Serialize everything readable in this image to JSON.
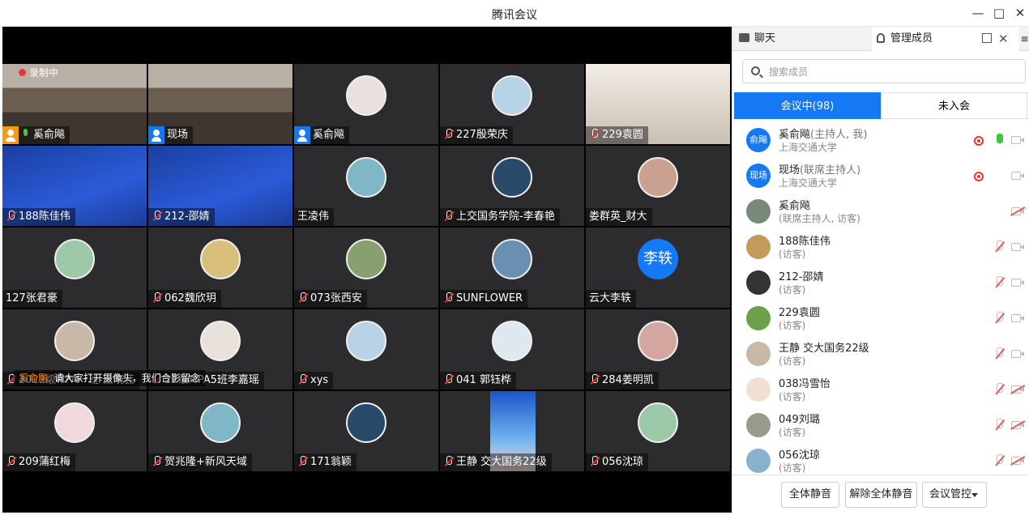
{
  "window": {
    "title": "腾讯会议"
  },
  "recording": {
    "label": "录制中"
  },
  "caption": {
    "speaker": "奚俞飚:",
    "text": "请大家打开摄像头，我们合影留念"
  },
  "tiles": [
    {
      "name": "奚俞飚",
      "kind": "room",
      "badge": "host"
    },
    {
      "name": "现场",
      "kind": "room",
      "badge": "cohost"
    },
    {
      "name": "奚俞飚",
      "kind": "avatar",
      "badge": "cohost-plain"
    },
    {
      "name": "227殷荣庆",
      "kind": "avatar",
      "mic": "off"
    },
    {
      "name": "229袁圆",
      "kind": "photo",
      "mic": "off"
    },
    {
      "name": "188陈佳伟",
      "kind": "screen",
      "mic": "off"
    },
    {
      "name": "212-邵婧",
      "kind": "screen",
      "mic": "off"
    },
    {
      "name": "王凌伟",
      "kind": "avatar"
    },
    {
      "name": "上交国务学院-李春艳",
      "kind": "avatar",
      "mic": "off"
    },
    {
      "name": "娄群英_财大",
      "kind": "avatar"
    },
    {
      "name": "127张君豪",
      "kind": "avatar"
    },
    {
      "name": "062魏欣玥",
      "kind": "avatar",
      "mic": "off"
    },
    {
      "name": "073张西安",
      "kind": "avatar",
      "mic": "off"
    },
    {
      "name": "SUNFLOWER",
      "kind": "avatar",
      "mic": "off"
    },
    {
      "name": "云大李轶",
      "kind": "letter",
      "letter": "李轶"
    },
    {
      "name": "2022级MPA一班-王晓芸",
      "kind": "avatar",
      "mic": "off"
    },
    {
      "name": "22级MPA5班李嘉瑶",
      "kind": "avatar",
      "mic": "off"
    },
    {
      "name": "xys",
      "kind": "avatar",
      "mic": "off"
    },
    {
      "name": "041 郭钰桦",
      "kind": "avatar",
      "mic": "off"
    },
    {
      "name": "284姜明凯",
      "kind": "avatar",
      "mic": "off"
    },
    {
      "name": "209蒲红梅",
      "kind": "avatar",
      "mic": "off"
    },
    {
      "name": "贺兆隆+新风天域",
      "kind": "avatar",
      "mic": "off"
    },
    {
      "name": "171翁颖",
      "kind": "avatar",
      "mic": "off"
    },
    {
      "name": "王静 交大国务22级",
      "kind": "phone",
      "mic": "off"
    },
    {
      "name": "056沈琼",
      "kind": "avatar",
      "mic": "off"
    }
  ],
  "panel": {
    "tab_chat": "聊天",
    "tab_members": "管理成员",
    "search_placeholder": "搜索成员",
    "seg_in": "会议中(98)",
    "seg_out": "未入会",
    "members": [
      {
        "name": "奚俞飚",
        "role": "(主持人, 我)",
        "sub": "上海交通大学",
        "avatar": "俞飚",
        "rec": true,
        "mic": "on",
        "cam": "on"
      },
      {
        "name": "现场",
        "role": "(联席主持人)",
        "sub": "上海交通大学",
        "avatar": "现场",
        "rec": true,
        "mic": "none",
        "cam": "on"
      },
      {
        "name": "奚俞飚",
        "role": "",
        "sub": "(联席主持人, 访客)",
        "avatar": "",
        "rec": false,
        "mic": "none",
        "cam": "off"
      },
      {
        "name": "188陈佳伟",
        "role": "",
        "sub": "(访客)",
        "avatar": "",
        "rec": false,
        "mic": "off",
        "cam": "on"
      },
      {
        "name": "212-邵婧",
        "role": "",
        "sub": "(访客)",
        "avatar": "",
        "rec": false,
        "mic": "off",
        "cam": "on"
      },
      {
        "name": "229袁圆",
        "role": "",
        "sub": "(访客)",
        "avatar": "",
        "rec": false,
        "mic": "off",
        "cam": "on"
      },
      {
        "name": "王静 交大国务22级",
        "role": "",
        "sub": "(访客)",
        "avatar": "",
        "rec": false,
        "mic": "off",
        "cam": "on"
      },
      {
        "name": "038冯雪怡",
        "role": "",
        "sub": "(访客)",
        "avatar": "",
        "rec": false,
        "mic": "off",
        "cam": "off"
      },
      {
        "name": "049刘璐",
        "role": "",
        "sub": "(访客)",
        "avatar": "",
        "rec": false,
        "mic": "off",
        "cam": "off"
      },
      {
        "name": "056沈琼",
        "role": "",
        "sub": "(访客)",
        "avatar": "",
        "rec": false,
        "mic": "off",
        "cam": "off"
      }
    ],
    "btn_mute_all": "全体静音",
    "btn_unmute_all": "解除全体静音",
    "btn_control": "会议管控"
  }
}
